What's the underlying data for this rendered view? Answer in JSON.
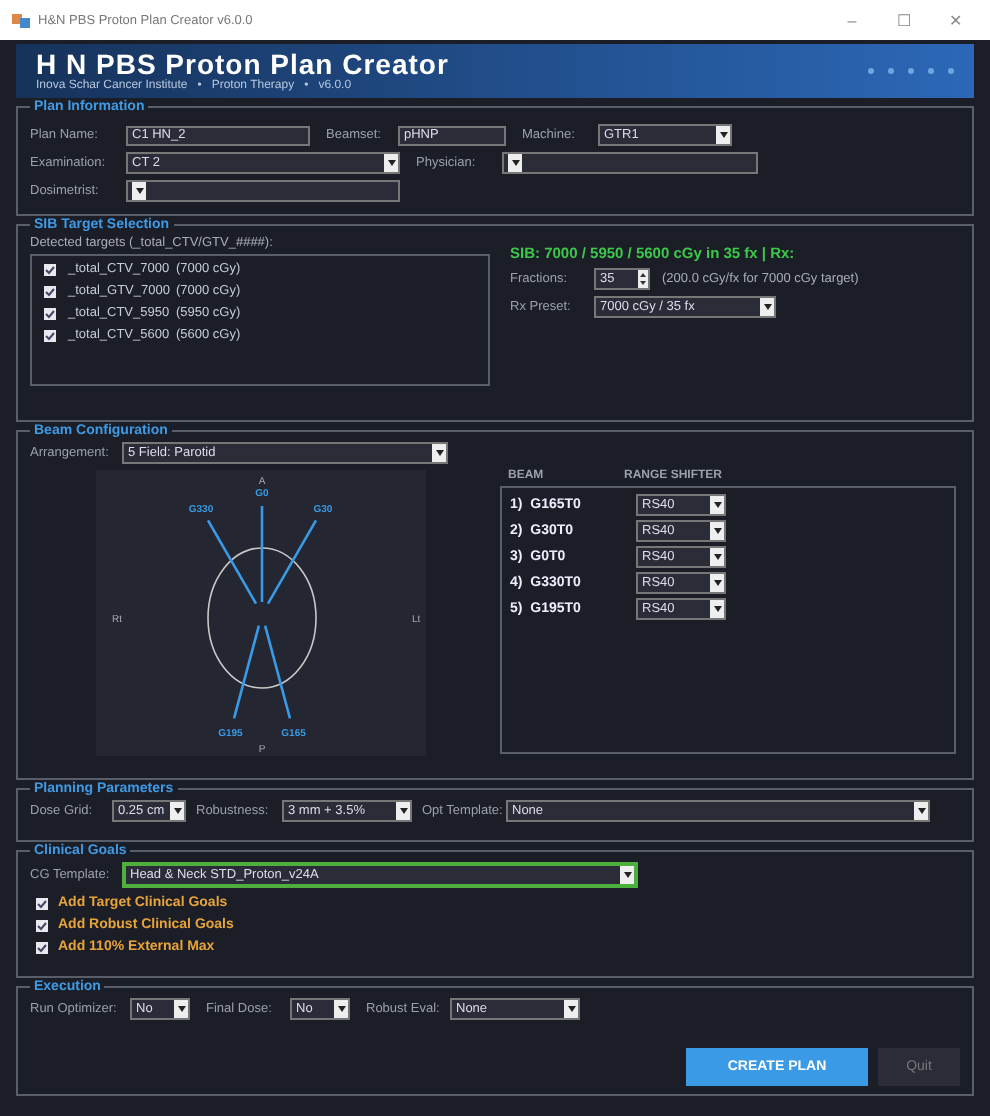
{
  "window": {
    "title": "H&N PBS Proton Plan Creator v6.0.0",
    "controls": [
      "–",
      "☐",
      "✕"
    ]
  },
  "header": {
    "title": "H N PBS Proton Plan Creator",
    "subtitle": [
      "Inova Schar Cancer Institute",
      "Proton Therapy",
      "v6.0.0"
    ],
    "separator": "•"
  },
  "plan_information": {
    "title": "Plan Information",
    "rows": [
      [
        {
          "label": "Plan Name:",
          "kind": "text",
          "value": "C1 HN_2"
        },
        {
          "label": "Beamset:",
          "kind": "text",
          "value": "pHNP"
        },
        {
          "label": "Machine:",
          "kind": "select",
          "value": "GTR1"
        }
      ],
      [
        {
          "label": "Examination:",
          "kind": "select",
          "value": "CT 2"
        },
        {
          "label": "Physician:",
          "kind": "select"
        }
      ],
      [
        {
          "label": "Dosimetrist:",
          "kind": "select"
        }
      ]
    ]
  },
  "sib_target_selection": {
    "title": "SIB Target Selection",
    "detected_label": "Detected targets (_total_CTV/GTV_####):",
    "targets": [
      {
        "name": "_total_CTV_7000",
        "dose": "(7000 cGy)",
        "checked": true
      },
      {
        "name": "_total_GTV_7000",
        "dose": "(7000 cGy)",
        "checked": true
      },
      {
        "name": "_total_CTV_5950",
        "dose": "(5950 cGy)",
        "checked": true
      },
      {
        "name": "_total_CTV_5600",
        "dose": "(5600 cGy)",
        "checked": true
      }
    ],
    "summary": "SIB: 7000 / 5950 / 5600 cGy in 35 fx  |  Rx:",
    "fractions": {
      "label": "Fractions:",
      "value": "35",
      "note": "(200.0 cGy/fx for 7000 cGy target)"
    },
    "rx_preset": {
      "label": "Rx Preset:",
      "value": "7000 cGy / 35 fx"
    }
  },
  "beam_configuration": {
    "title": "Beam Configuration",
    "arrangement": {
      "label": "Arrangement:",
      "value": "5 Field: Parotid"
    },
    "diagram": {
      "anterior": "A",
      "posterior": "P",
      "right": "Rt",
      "left": "Lt",
      "beams": [
        {
          "label": "G0"
        },
        {
          "label": "G330"
        },
        {
          "label": "G30"
        },
        {
          "label": "G195"
        },
        {
          "label": "G165"
        }
      ]
    },
    "columns": [
      "BEAM",
      "RANGE SHIFTER"
    ],
    "beams": [
      {
        "index": "1)",
        "name": "G165T0",
        "range_shifter": "RS40"
      },
      {
        "index": "2)",
        "name": "G30T0",
        "range_shifter": "RS40"
      },
      {
        "index": "3)",
        "name": "G0T0",
        "range_shifter": "RS40"
      },
      {
        "index": "4)",
        "name": "G330T0",
        "range_shifter": "RS40"
      },
      {
        "index": "5)",
        "name": "G195T0",
        "range_shifter": "RS40"
      }
    ]
  },
  "planning_parameters": {
    "title": "Planning Parameters",
    "fields": [
      {
        "label": "Dose Grid:",
        "value": "0.25 cm"
      },
      {
        "label": "Robustness:",
        "value": "3 mm + 3.5%"
      },
      {
        "label": "Opt Template:",
        "value": "None"
      }
    ]
  },
  "clinical_goals": {
    "title": "Clinical Goals",
    "template": {
      "label": "CG Template:",
      "value": "Head & Neck STD_Proton_v24A"
    },
    "options": [
      {
        "label": "Add Target Clinical Goals",
        "checked": true
      },
      {
        "label": "Add Robust Clinical Goals",
        "checked": true
      },
      {
        "label": "Add 110% External Max",
        "checked": true
      }
    ]
  },
  "execution": {
    "title": "Execution",
    "fields": [
      {
        "label": "Run Optimizer:",
        "value": "No"
      },
      {
        "label": "Final Dose:",
        "value": "No"
      },
      {
        "label": "Robust Eval:",
        "value": "None"
      }
    ],
    "buttons": [
      {
        "label": "CREATE PLAN",
        "kind": "primary",
        "disabled": false
      },
      {
        "label": "Quit",
        "kind": "secondary",
        "disabled": true
      }
    ]
  }
}
